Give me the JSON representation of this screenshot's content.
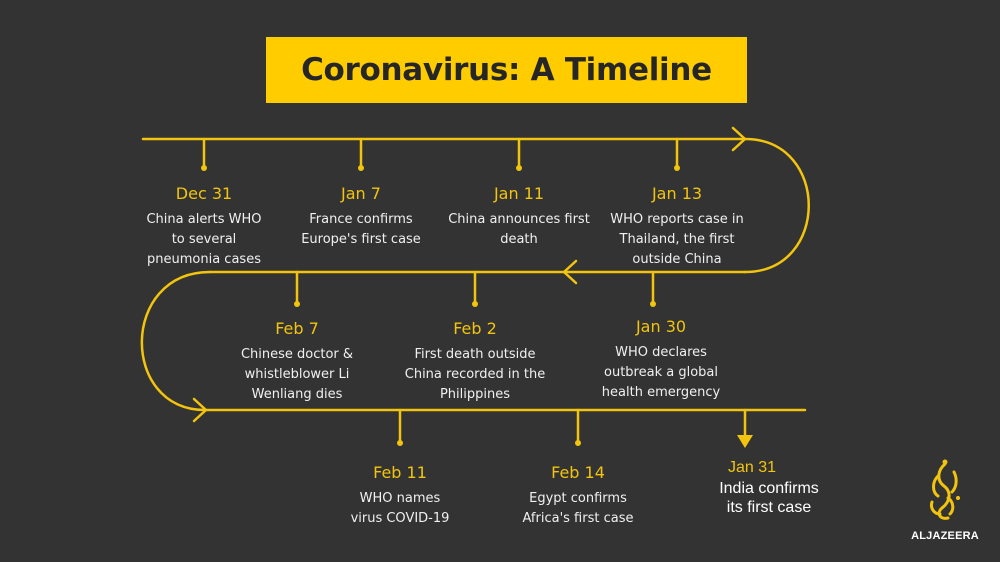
{
  "title": "Coronavirus: A Timeline",
  "colors": {
    "background": "#333333",
    "accent": "#FFCC00",
    "line": "#F2C40E",
    "text": "#F0F0F0"
  },
  "events": [
    {
      "date": "Dec 31",
      "text": "China alerts WHO to several pneumonia cases"
    },
    {
      "date": "Jan 7",
      "text": "France confirms Europe's first case"
    },
    {
      "date": "Jan 11",
      "text": "China announces first death"
    },
    {
      "date": "Jan 13",
      "text": "WHO reports case in Thailand, the first outside China"
    },
    {
      "date": "Jan 30",
      "text": "WHO declares outbreak a global health emergency"
    },
    {
      "date": "Feb 2",
      "text": "First death outside China recorded in the Philippines"
    },
    {
      "date": "Feb 7",
      "text": "Chinese doctor & whistleblower Li Wenliang dies"
    },
    {
      "date": "Feb 11",
      "text": "WHO names virus COVID-19"
    },
    {
      "date": "Feb 14",
      "text": "Egypt confirms Africa's first case"
    },
    {
      "date": "Jan 31",
      "text": "India confirms its first case"
    }
  ],
  "logo": {
    "name": "ALJAZEERA",
    "icon": "aljazeera-logo-icon"
  }
}
